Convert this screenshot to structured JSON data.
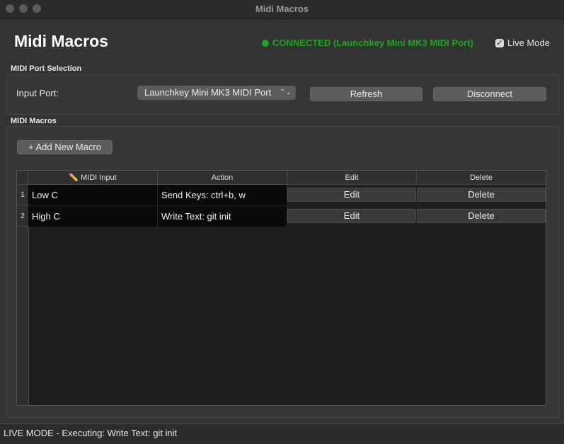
{
  "window": {
    "title": "Midi Macros"
  },
  "header": {
    "app_title": "Midi Macros",
    "status_text": "CONNECTED (Launchkey Mini MK3 MIDI Port)",
    "status_color": "#1fa51f",
    "live_mode_label": "Live Mode",
    "live_mode_checked": true
  },
  "port_section": {
    "label": "MIDI Port Selection",
    "input_port_label": "Input Port:",
    "selected_port": "Launchkey Mini MK3 MIDI Port",
    "refresh_label": "Refresh",
    "disconnect_label": "Disconnect"
  },
  "macros_section": {
    "label": "MIDI Macros",
    "add_button_label": "+ Add New Macro",
    "columns": [
      "MIDI Input",
      "Action",
      "Edit",
      "Delete"
    ],
    "midi_input_icon": "pencil-icon",
    "rows": [
      {
        "num": "1",
        "midi_input": "Low C",
        "action": "Send Keys: ctrl+b, w",
        "edit": "Edit",
        "delete": "Delete"
      },
      {
        "num": "2",
        "midi_input": "High C",
        "action": "Write Text: git init",
        "edit": "Edit",
        "delete": "Delete"
      }
    ]
  },
  "statusbar": {
    "text": "LIVE MODE - Executing: Write Text: git init"
  }
}
